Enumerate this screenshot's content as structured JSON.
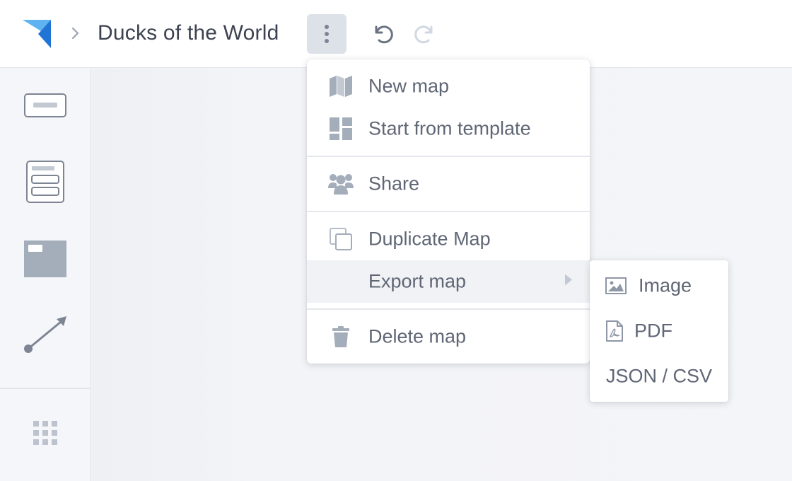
{
  "header": {
    "title": "Ducks of the World",
    "logo_icon": "app-logo",
    "breadcrumb_icon": "chevron-right-icon",
    "more_icon": "vertical-ellipsis-icon",
    "undo_icon": "undo-icon",
    "redo_icon": "redo-icon",
    "redo_enabled": false
  },
  "toolbar": {
    "tools": [
      {
        "name": "text-block-tool",
        "icon": "text-block-icon"
      },
      {
        "name": "list-block-tool",
        "icon": "list-block-icon"
      },
      {
        "name": "image-block-tool",
        "icon": "image-block-icon"
      },
      {
        "name": "connector-tool",
        "icon": "arrow-connector-icon"
      },
      {
        "name": "more-tools",
        "icon": "grid-icon"
      }
    ]
  },
  "menu": {
    "items": [
      {
        "label": "New map",
        "icon": "map-icon"
      },
      {
        "label": "Start from template",
        "icon": "template-icon"
      },
      {
        "label": "Share",
        "icon": "users-icon"
      },
      {
        "label": "Duplicate Map",
        "icon": "copy-icon"
      },
      {
        "label": "Export map",
        "icon": "",
        "submenu": true,
        "active": true
      },
      {
        "label": "Delete map",
        "icon": "trash-icon"
      }
    ]
  },
  "export_submenu": {
    "items": [
      {
        "label": "Image",
        "icon": "image-icon"
      },
      {
        "label": "PDF",
        "icon": "pdf-file-icon"
      },
      {
        "label": "JSON / CSV",
        "icon": ""
      }
    ]
  },
  "colors": {
    "accent_blue": "#3b8ee8",
    "icon_gray": "#9aa3b2",
    "text": "#5f6675",
    "title": "#3c4250"
  }
}
